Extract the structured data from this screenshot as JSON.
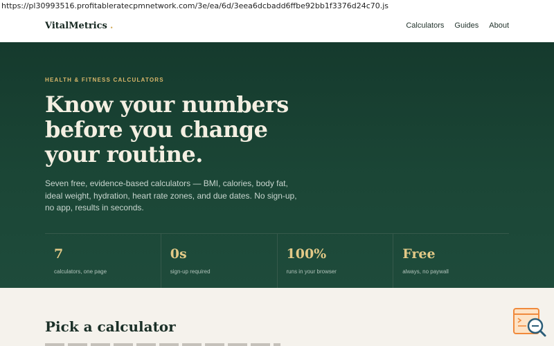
{
  "browser": {
    "url": "https://pl30993516.profitableratecpmnetwork.com/3e/ea/6d/3eea6dcbadd6ffbe92bb1f3376d24c70.js"
  },
  "nav": {
    "brand": "VitalMetrics",
    "brand_dot": ".",
    "links": [
      "Calculators",
      "Guides",
      "About"
    ]
  },
  "hero": {
    "eyebrow": "HEALTH & FITNESS CALCULATORS",
    "headline": "Know your numbers before you change your routine.",
    "description": "Seven free, evidence-based calculators — BMI, calories, body fat, ideal weight, hydration, heart rate zones, and due dates. No sign-up, no app, results in seconds.",
    "stats": [
      {
        "value": "7",
        "label": "calculators, one page"
      },
      {
        "value": "0s",
        "label": "sign-up required"
      },
      {
        "value": "100%",
        "label": "runs in your browser"
      },
      {
        "value": "Free",
        "label": "always, no paywall"
      }
    ]
  },
  "calculators_section": {
    "title": "Pick a calculator"
  },
  "colors": {
    "hero_bg": "#1b4636",
    "accent_gold": "#d9b76a",
    "page_bg": "#f5f2ec"
  },
  "icons": {
    "help_widget": "search-help-icon"
  }
}
